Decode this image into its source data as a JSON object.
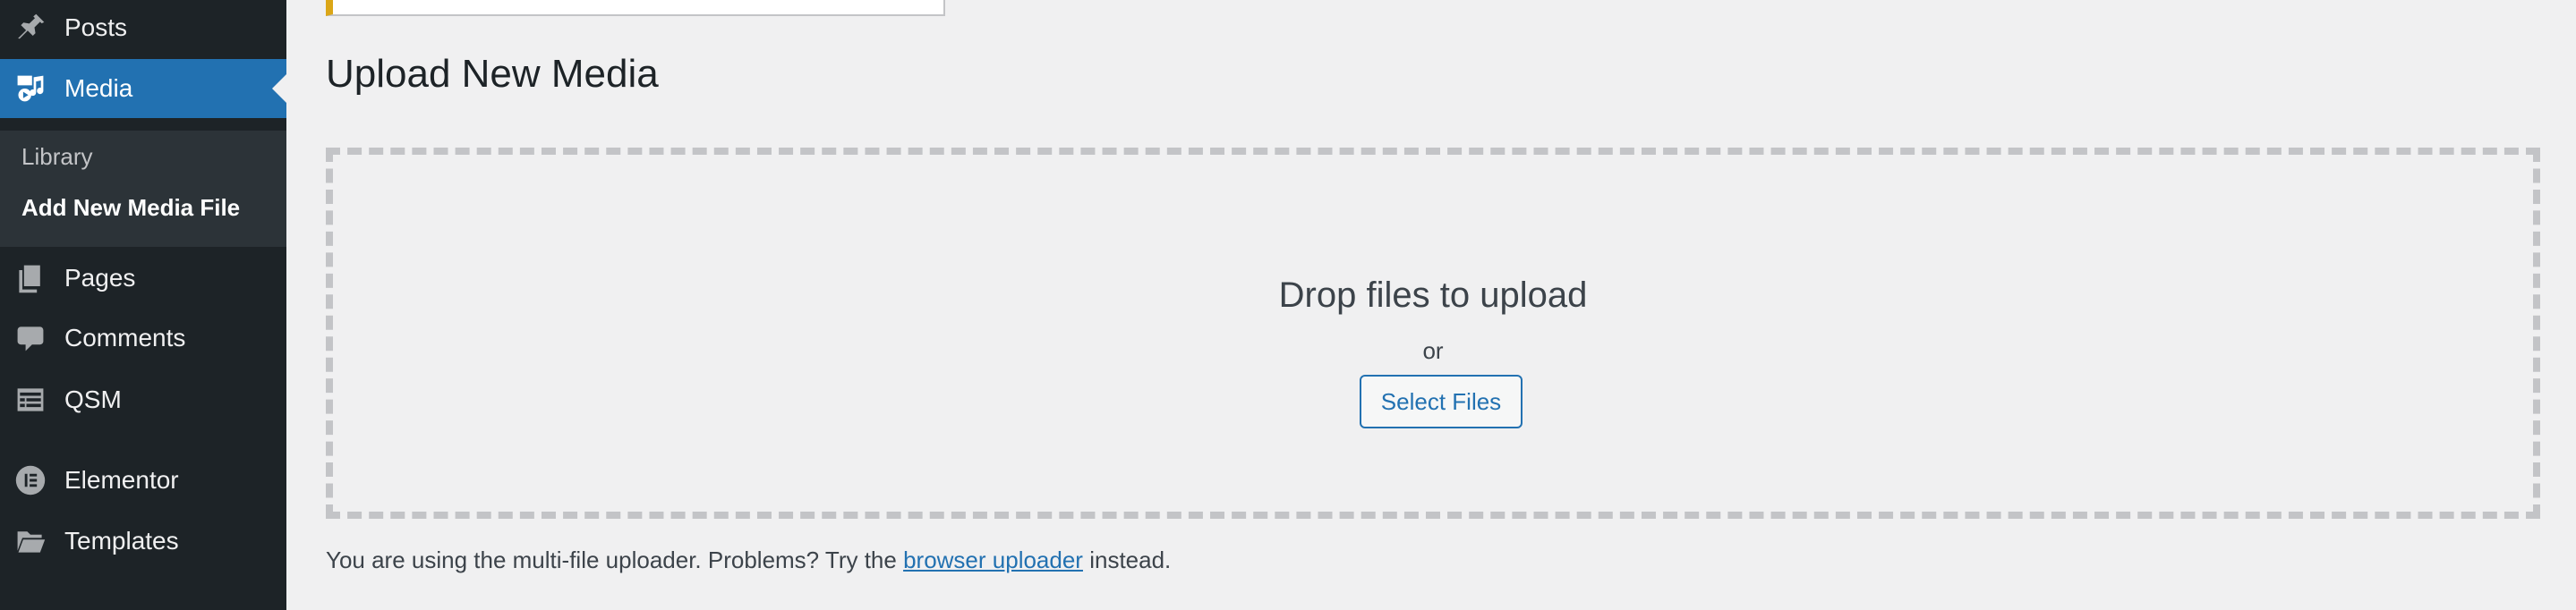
{
  "sidebar": {
    "items": [
      {
        "id": "posts",
        "label": "Posts",
        "icon": "pushpin-icon",
        "active": false
      },
      {
        "id": "media",
        "label": "Media",
        "icon": "media-icon",
        "active": true
      },
      {
        "id": "pages",
        "label": "Pages",
        "icon": "pages-icon",
        "active": false
      },
      {
        "id": "comments",
        "label": "Comments",
        "icon": "comment-icon",
        "active": false
      },
      {
        "id": "qsm",
        "label": "QSM",
        "icon": "list-view-icon",
        "active": false
      },
      {
        "id": "elementor",
        "label": "Elementor",
        "icon": "elementor-icon",
        "active": false
      },
      {
        "id": "templates",
        "label": "Templates",
        "icon": "folder-icon",
        "active": false
      }
    ],
    "submenu": {
      "library": "Library",
      "add_new": "Add New Media File"
    }
  },
  "main": {
    "title": "Upload New Media",
    "drop_zone": {
      "title": "Drop files to upload",
      "or": "or",
      "button": "Select Files"
    },
    "note": {
      "prefix": "You are using the multi-file uploader. Problems? Try the",
      "link": "browser uploader",
      "suffix": "instead."
    }
  },
  "colors": {
    "sidebar_bg": "#1d2327",
    "submenu_bg": "#2c3338",
    "accent": "#2271b1",
    "page_bg": "#f0f0f1",
    "notice_border": "#dba617"
  }
}
